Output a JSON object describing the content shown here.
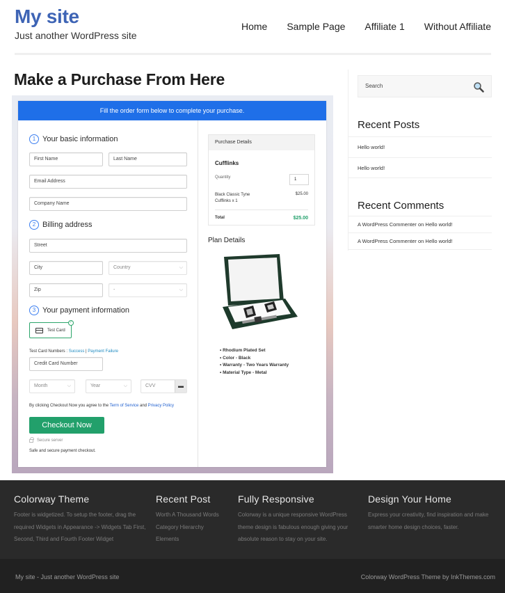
{
  "header": {
    "site_title": "My site",
    "tagline": "Just another WordPress site",
    "nav": [
      "Home",
      "Sample Page",
      "Affiliate 1",
      "Without Affiliate"
    ]
  },
  "page": {
    "title": "Make a Purchase From Here"
  },
  "form": {
    "banner": "Fill the order form below to complete your purchase.",
    "sections": {
      "basic": {
        "num": "1",
        "label": "Your basic information"
      },
      "billing": {
        "num": "2",
        "label": "Billing address"
      },
      "payment": {
        "num": "3",
        "label": "Your payment information"
      }
    },
    "placeholders": {
      "first_name": "First Name",
      "last_name": "Last Name",
      "email": "Email Address",
      "company": "Company Name",
      "street": "Street",
      "city": "City",
      "country": "Country",
      "zip": "Zip",
      "state": "-",
      "card_number": "Credit Card Number",
      "month": "Month",
      "year": "Year",
      "cvv": "CVV"
    },
    "payment_method": "Test Card",
    "test_numbers_label": "Test Card Numbers : ",
    "test_success": "Success",
    "test_separator": " | ",
    "test_failure": "Payment Failure",
    "agree_prefix": "By clicking Checkout Now you agree to the ",
    "terms_link": "Term of Service",
    "agree_and": " and ",
    "privacy_link": "Privacy Policy",
    "checkout_button": "Checkout Now",
    "secure_server": "Secure server",
    "safe_text": "Safe and secure payment checkout."
  },
  "purchase": {
    "header": "Purchase Details",
    "product": "Cufflinks",
    "quantity_label": "Quantity",
    "quantity": "1",
    "item_line": "Black Classic Tyne Cufflinks x 1",
    "item_price": "$25.00",
    "total_label": "Total",
    "total": "$25.00",
    "plan_title": "Plan Details",
    "plan_features": [
      "Rhodium Plated Set",
      "Color - Black",
      "Warranty - Two Years Warranty",
      "Material Type - Metal"
    ]
  },
  "sidebar": {
    "search_placeholder": "Search",
    "recent_posts_title": "Recent Posts",
    "recent_posts": [
      "Hello world!",
      "Hello world!"
    ],
    "recent_comments_title": "Recent Comments",
    "recent_comments": [
      "A WordPress Commenter on Hello world!",
      "A WordPress Commenter on Hello world!"
    ]
  },
  "footer": {
    "columns": [
      {
        "title": "Colorway Theme",
        "text": "Footer is widgetized. To setup the footer, drag the required Widgets in Appearance -> Widgets Tab First, Second, Third and Fourth Footer Widget"
      },
      {
        "title": "Recent Post",
        "links": [
          "Worth A Thousand Words",
          "Category Hierarchy",
          "Elements"
        ]
      },
      {
        "title": "Fully Responsive",
        "text": "Colorway is a unique responsive WordPress theme design is fabulous enough giving your absolute reason to stay on your site."
      },
      {
        "title": "Design Your Home",
        "text": "Express your creativity, find inspiration and make smarter home design choices, faster."
      }
    ],
    "bottom_left": "My site - Just another WordPress site",
    "bottom_right": "Colorway WordPress Theme by InkThemes.com"
  },
  "colors": {
    "brand": "#3e64b5",
    "banner": "#1f6fe8",
    "checkout": "#22a06b",
    "footer": "#2a2a2a"
  }
}
